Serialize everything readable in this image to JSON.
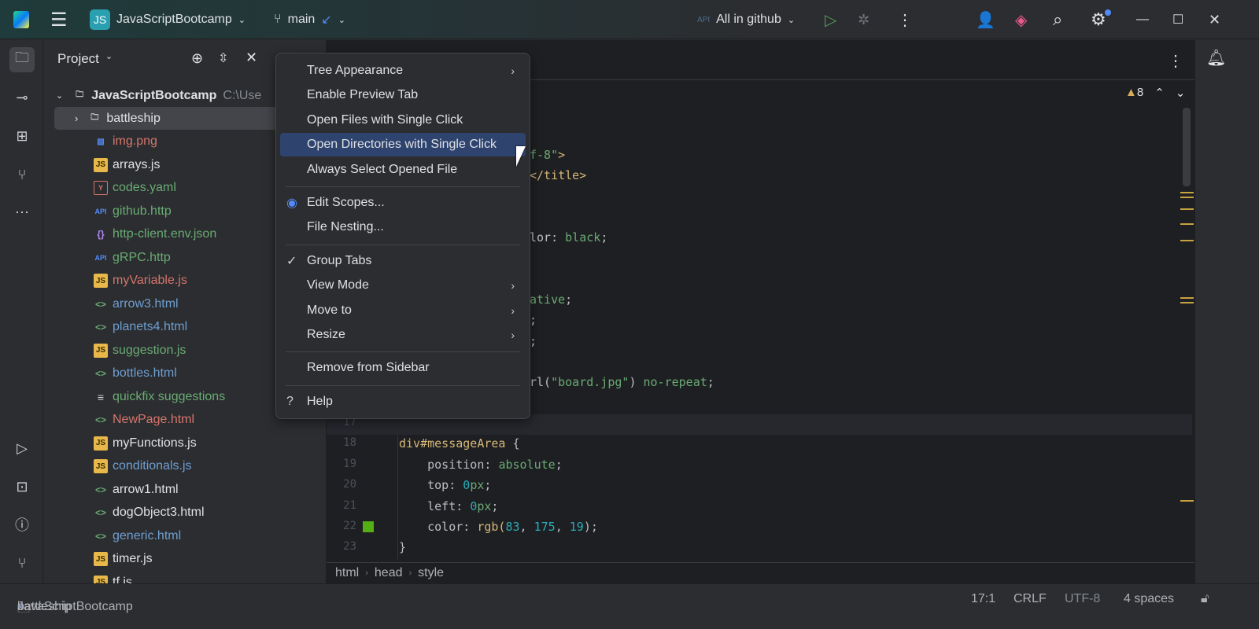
{
  "titlebar": {
    "project": "JavaScriptBootcamp",
    "project_badge": "JS",
    "branch": "main",
    "run_config": "All in github"
  },
  "project_panel": {
    "title": "Project",
    "root": {
      "name": "JavaScriptBootcamp",
      "path": "C:\\Use"
    },
    "items": [
      {
        "name": "battleship",
        "type": "folder",
        "color": "#dfe1e5"
      },
      {
        "name": "img.png",
        "type": "image",
        "color": "#d5756c"
      },
      {
        "name": "arrays.js",
        "type": "js",
        "color": "#dfe1e5"
      },
      {
        "name": "codes.yaml",
        "type": "yaml",
        "color": "#6aab73"
      },
      {
        "name": "github.http",
        "type": "api",
        "color": "#6aab73"
      },
      {
        "name": "http-client.env.json",
        "type": "json",
        "color": "#6aab73"
      },
      {
        "name": "gRPC.http",
        "type": "api",
        "color": "#6aab73"
      },
      {
        "name": "myVariable.js",
        "type": "js",
        "color": "#d5756c"
      },
      {
        "name": "arrow3.html",
        "type": "html",
        "color": "#6f9fd1"
      },
      {
        "name": "planets4.html",
        "type": "html",
        "color": "#6f9fd1"
      },
      {
        "name": "suggestion.js",
        "type": "js",
        "color": "#6aab73"
      },
      {
        "name": "bottles.html",
        "type": "html",
        "color": "#6f9fd1"
      },
      {
        "name": "quickfix suggestions",
        "type": "text",
        "color": "#6aab73"
      },
      {
        "name": "NewPage.html",
        "type": "html",
        "color": "#d5756c"
      },
      {
        "name": "myFunctions.js",
        "type": "js",
        "color": "#dfe1e5"
      },
      {
        "name": "conditionals.js",
        "type": "js",
        "color": "#6f9fd1"
      },
      {
        "name": "arrow1.html",
        "type": "html",
        "color": "#dfe1e5"
      },
      {
        "name": "dogObject3.html",
        "type": "html",
        "color": "#dfe1e5"
      },
      {
        "name": "generic.html",
        "type": "html",
        "color": "#6f9fd1"
      },
      {
        "name": "timer.js",
        "type": "js",
        "color": "#dfe1e5"
      },
      {
        "name": "tf.js",
        "type": "js",
        "color": "#dfe1e5"
      }
    ]
  },
  "context_menu": {
    "items": [
      {
        "label": "Tree Appearance",
        "submenu": true
      },
      {
        "label": "Enable Preview Tab"
      },
      {
        "label": "Open Files with Single Click"
      },
      {
        "label": "Open Directories with Single Click",
        "selected": true
      },
      {
        "label": "Always Select Opened File"
      },
      {
        "separator": true
      },
      {
        "label": "Edit Scopes...",
        "icon": "scope-icon"
      },
      {
        "label": "File Nesting..."
      },
      {
        "separator": true
      },
      {
        "label": "Group Tabs",
        "checked": true
      },
      {
        "label": "View Mode",
        "submenu": true
      },
      {
        "label": "Move to",
        "submenu": true
      },
      {
        "label": "Resize",
        "submenu": true
      },
      {
        "separator": true
      },
      {
        "label": "Remove from Sidebar"
      },
      {
        "separator": true
      },
      {
        "label": "Help",
        "icon": "help-icon"
      }
    ]
  },
  "editor": {
    "warnings": "8",
    "fragments": [
      {
        "line": 4,
        "parts": [
          [
            "f-8\"",
            "#6aab73"
          ],
          [
            ">",
            "#d5b778"
          ]
        ]
      },
      {
        "line": 5,
        "parts": [
          [
            "</title>",
            "#d5b778"
          ]
        ]
      },
      {
        "line": 8,
        "parts": [
          [
            "lor: ",
            "#bcbec4"
          ],
          [
            "black",
            "#6aab73"
          ],
          [
            ";",
            "#bcbec4"
          ]
        ]
      },
      {
        "line": 11,
        "parts": [
          [
            "ative",
            "#6aab73"
          ],
          [
            ";",
            "#bcbec4"
          ]
        ]
      },
      {
        "line": 12,
        "parts": [
          [
            ";",
            "#bcbec4"
          ]
        ]
      },
      {
        "line": 13,
        "parts": [
          [
            ";",
            "#bcbec4"
          ]
        ]
      },
      {
        "line": 15,
        "parts": [
          [
            "rl(",
            "#bcbec4"
          ],
          [
            "\"board.jpg\"",
            "#6aab73"
          ],
          [
            ") ",
            "#bcbec4"
          ],
          [
            "no-repeat",
            "#6aab73"
          ],
          [
            ";",
            "#bcbec4"
          ]
        ]
      }
    ],
    "lines": [
      {
        "n": "17",
        "parts": []
      },
      {
        "n": "18",
        "parts": [
          [
            "div#messageArea ",
            "#d5b778"
          ],
          [
            "{",
            "#bcbec4"
          ]
        ]
      },
      {
        "n": "19",
        "parts": [
          [
            "    position: ",
            "#bcbec4"
          ],
          [
            "absolute",
            "#6aab73"
          ],
          [
            ";",
            "#bcbec4"
          ]
        ]
      },
      {
        "n": "20",
        "parts": [
          [
            "    top: ",
            "#bcbec4"
          ],
          [
            "0",
            "#2aacb8"
          ],
          [
            "px",
            "#6aab73"
          ],
          [
            ";",
            "#bcbec4"
          ]
        ]
      },
      {
        "n": "21",
        "parts": [
          [
            "    left: ",
            "#bcbec4"
          ],
          [
            "0",
            "#2aacb8"
          ],
          [
            "px",
            "#6aab73"
          ],
          [
            ";",
            "#bcbec4"
          ]
        ]
      },
      {
        "n": "22",
        "parts": [
          [
            "    color: ",
            "#bcbec4"
          ],
          [
            "rgb(",
            "#d5b778"
          ],
          [
            "83",
            "#2aacb8"
          ],
          [
            ", ",
            "#bcbec4"
          ],
          [
            "175",
            "#2aacb8"
          ],
          [
            ", ",
            "#bcbec4"
          ],
          [
            "19",
            "#2aacb8"
          ],
          [
            ");",
            "#bcbec4"
          ]
        ],
        "swatch": "#53af13"
      },
      {
        "n": "23",
        "parts": [
          [
            "}",
            "#bcbec4"
          ]
        ]
      }
    ],
    "breadcrumbs": [
      "html",
      "head",
      "style"
    ]
  },
  "statusbar": {
    "path": [
      "JavaScriptBootcamp",
      "battleship"
    ],
    "position": "17:1",
    "line_ending": "CRLF",
    "encoding": "UTF-8",
    "indent": "4 spaces"
  }
}
